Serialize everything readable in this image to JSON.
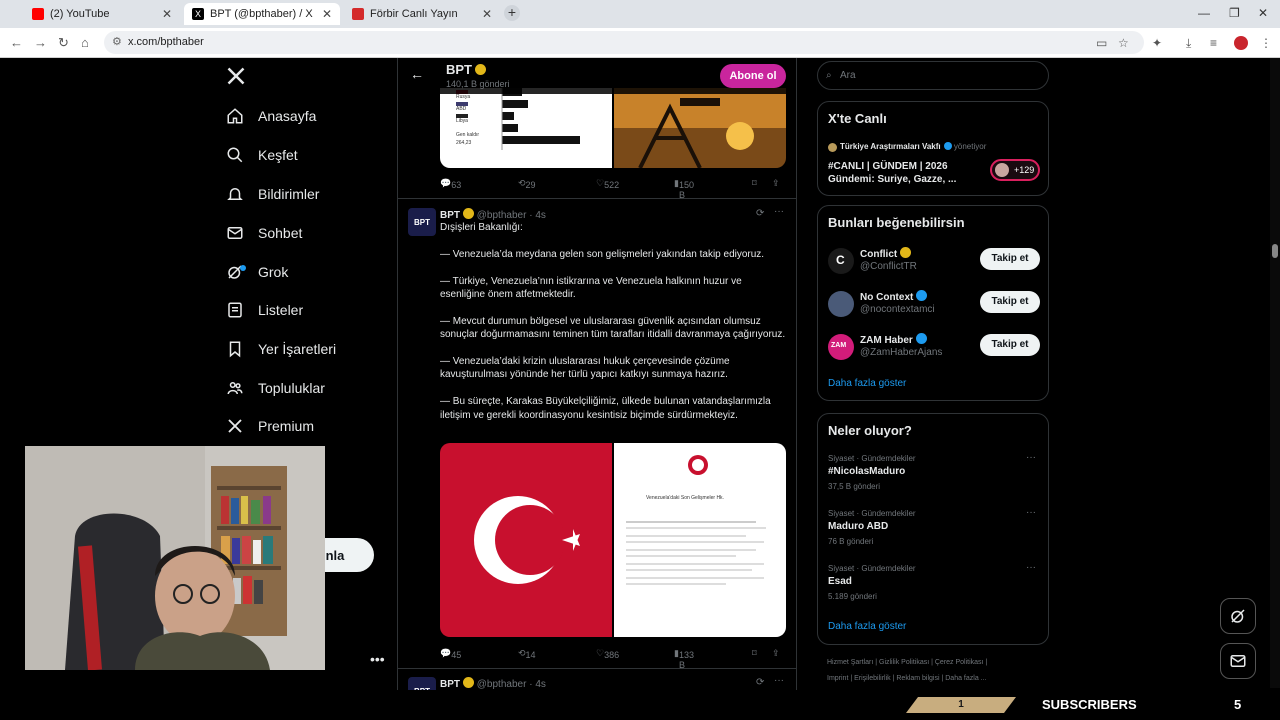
{
  "browser": {
    "tabs": [
      {
        "title": "(2) YouTube",
        "icon": "youtube-icon",
        "color": "#ff0000"
      },
      {
        "title": "BPT (@bpthaber) / X",
        "icon": "x-icon",
        "color": "#000000"
      },
      {
        "title": "Förbir Canlı Yayın",
        "icon": "forbir-icon",
        "color": "#d42a2a"
      }
    ],
    "url": "x.com/bpthaber"
  },
  "nav": {
    "items": [
      {
        "label": "Anasayfa",
        "icon": "home-icon"
      },
      {
        "label": "Keşfet",
        "icon": "search-icon"
      },
      {
        "label": "Bildirimler",
        "icon": "bell-icon"
      },
      {
        "label": "Sohbet",
        "icon": "mail-icon"
      },
      {
        "label": "Grok",
        "icon": "grok-icon"
      },
      {
        "label": "Listeler",
        "icon": "list-icon"
      },
      {
        "label": "Yer İşaretleri",
        "icon": "bookmark-icon"
      },
      {
        "label": "Topluluklar",
        "icon": "communities-icon"
      },
      {
        "label": "Premium",
        "icon": "x-premium-icon"
      }
    ],
    "post_button_label": "nla"
  },
  "profile_header": {
    "name": "BPT",
    "sub": "140,1 B gönderi",
    "subscribe_label": "Abone ol"
  },
  "prev_post": {
    "chart_labels": [
      "Rusya",
      "ABD",
      "Libya",
      "Gen kaldır",
      "264,23"
    ],
    "stats": {
      "replies": "63",
      "reposts": "29",
      "likes": "522",
      "views": "150 B"
    }
  },
  "post": {
    "avatar_text": "BPT",
    "author": "BPT",
    "handle": "@bpthaber",
    "time": "4s",
    "paragraphs": [
      "Dışişleri Bakanlığı:",
      "— Venezuela’da meydana gelen son gelişmeleri yakından takip ediyoruz.",
      "— Türkiye, Venezuela’nın istikrarına ve Venezuela halkının huzur ve esenliğine önem atfetmektedir.",
      "— Mevcut durumun bölgesel ve uluslararası güvenlik açısından olumsuz sonuçlar doğurmamasını teminen tüm tarafları itidalli davranmaya çağırıyoruz.",
      "— Venezuela’daki krizin uluslararası hukuk çerçevesinde çözüme kavuşturulması yönünde her türlü yapıcı katkıyı sunmaya hazırız.",
      "— Bu süreçte, Karakas Büyükelçiliğimiz, ülkede bulunan vatandaşlarımızla iletişim ve gerekli koordinasyonu kesintisiz biçimde sürdürmekteyiz."
    ],
    "doc_title": "Venezuela'daki Son Gelişmeler Hk.",
    "stats": {
      "replies": "45",
      "reposts": "14",
      "likes": "386",
      "views": "133 B"
    }
  },
  "next_post": {
    "author": "BPT",
    "handle": "@bpthaber",
    "time": "4s"
  },
  "search": {
    "placeholder": "Ara"
  },
  "live": {
    "title": "X'te Canlı",
    "host": "Türkiye Araştırmaları Vakfı",
    "host_role": "yönetiyor",
    "headline": "#CANLI | GÜNDEM | 2026 Gündemi: Suriye, Gazze, ...",
    "listeners": "+129"
  },
  "suggestions": {
    "title": "Bunları beğenebilirsin",
    "items": [
      {
        "name": "Conflict",
        "handle": "@ConflictTR",
        "button": "Takip et",
        "avatar_color": "#1a1a1a",
        "verified": "gold"
      },
      {
        "name": "No Context",
        "handle": "@nocontextamci",
        "button": "Takip et",
        "avatar_color": "#4a5a78",
        "verified": "blue"
      },
      {
        "name": "ZAM Haber",
        "handle": "@ZamHaberAjans",
        "button": "Takip et",
        "avatar_color": "#d21c7a",
        "verified": "blue"
      }
    ],
    "more": "Daha fazla göster"
  },
  "trends": {
    "title": "Neler oluyor?",
    "items": [
      {
        "category": "Siyaset · Gündemdekiler",
        "name": "#NicolasMaduro",
        "count": "37,5 B gönderi"
      },
      {
        "category": "Siyaset · Gündemdekiler",
        "name": "Maduro ABD",
        "count": "76 B gönderi"
      },
      {
        "category": "Siyaset · Gündemdekiler",
        "name": "Esad",
        "count": "5.189 gönderi"
      }
    ],
    "more": "Daha fazla göster"
  },
  "footer": {
    "line1": "Hizmet Şartları  |  Gizlilik Politikası  |  Çerez Politikası  |",
    "line2": "Imprint  |  Erişilebilirlik  |  Reklam bilgisi  |  Daha fazla ..."
  },
  "stream": {
    "badge": "1",
    "label": "SUBSCRIBERS",
    "count": "5"
  },
  "colors": {
    "accent": "#1d9bf0",
    "subscribe": "#c9259d",
    "flag_red": "#c8102e"
  }
}
